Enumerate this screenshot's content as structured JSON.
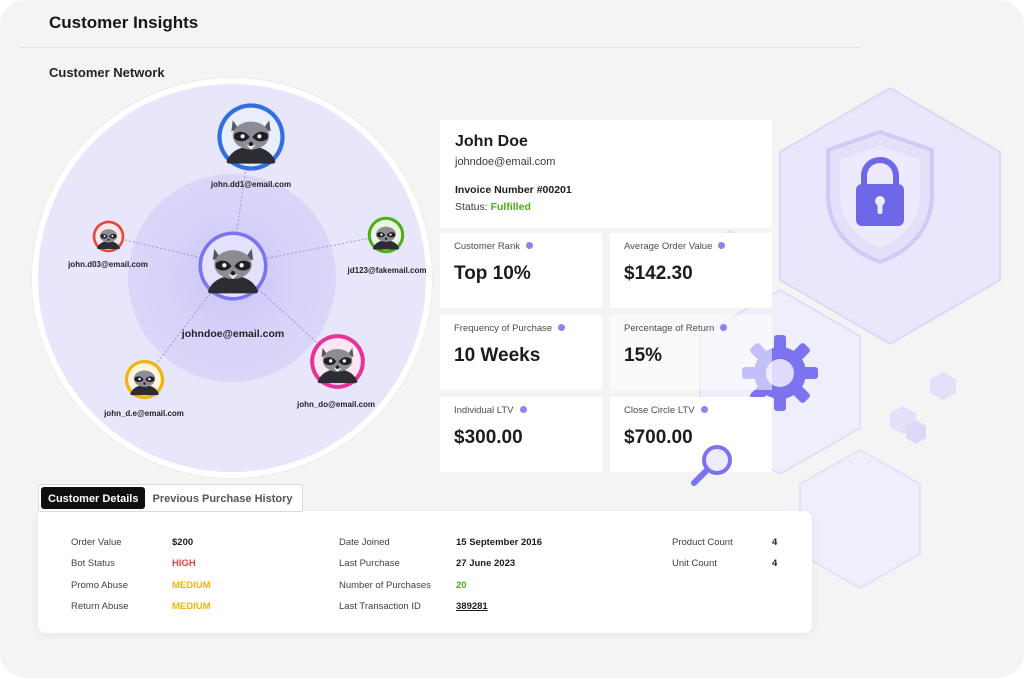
{
  "header": {
    "title": "Customer Insights"
  },
  "network": {
    "title": "Customer Network",
    "center": {
      "email": "johndoe@email.com",
      "color": "#7b74ee"
    },
    "nodes": [
      {
        "email": "john.dd1@email.com",
        "color": "#2f6fe0"
      },
      {
        "email": "john.d03@email.com",
        "color": "#e8453c"
      },
      {
        "email": "jd123@fakemail.com",
        "color": "#4cae18"
      },
      {
        "email": "john_d.e@email.com",
        "color": "#efb50c"
      },
      {
        "email": "john_do@email.com",
        "color": "#e8329b"
      }
    ]
  },
  "profile": {
    "name": "John Doe",
    "email": "johndoe@email.com",
    "invoice": "Invoice Number #00201",
    "status_label": "Status:",
    "status_value": "Fulfilled"
  },
  "metrics": [
    {
      "label": "Customer Rank",
      "value": "Top 10%"
    },
    {
      "label": "Average Order Value",
      "value": "$142.30"
    },
    {
      "label": "Frequency of Purchase",
      "value": "10 Weeks"
    },
    {
      "label": "Percentage of Return",
      "value": "15%"
    },
    {
      "label": "Individual LTV",
      "value": "$300.00"
    },
    {
      "label": "Close Circle LTV",
      "value": "$700.00"
    }
  ],
  "tabs": [
    {
      "label": "Customer Details",
      "active": true
    },
    {
      "label": "Previous Purchase History",
      "active": false
    }
  ],
  "details": {
    "col1": [
      {
        "label": "Order Value",
        "value": "$200"
      },
      {
        "label": "Bot Status",
        "value": "HIGH"
      },
      {
        "label": "Promo Abuse",
        "value": "MEDIUM"
      },
      {
        "label": "Return Abuse",
        "value": "MEDIUM"
      }
    ],
    "col2": [
      {
        "label": "Date Joined",
        "value": "15 September 2016"
      },
      {
        "label": "Last Purchase",
        "value": "27 June 2023"
      },
      {
        "label": "Number of Purchases",
        "value": "20"
      },
      {
        "label": "Last Transaction ID",
        "value": "389281"
      }
    ],
    "col3": [
      {
        "label": "Product Count",
        "value": "4"
      },
      {
        "label": "Unit Count",
        "value": "4"
      }
    ]
  },
  "icons": {
    "shield": "shield-lock-icon",
    "gear": "gear-icon",
    "magnifier": "magnifier-icon",
    "info": "info-icon",
    "avatar": "raccoon-avatar-icon"
  },
  "colors": {
    "accent": "#7b74ee",
    "status_high": "#e8453c",
    "status_medium": "#efb50c",
    "status_good": "#4cae18"
  }
}
